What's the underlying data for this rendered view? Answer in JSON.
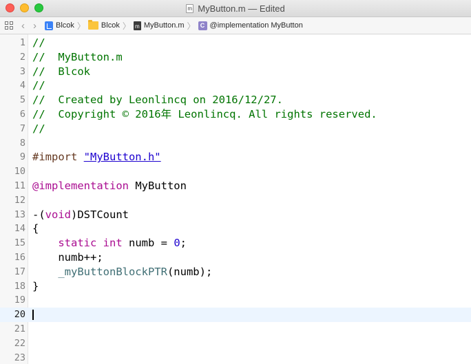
{
  "window": {
    "title": "MyButton.m — Edited",
    "file_badge": "m"
  },
  "jumpbar": {
    "crumbs": [
      {
        "label": "Blcok",
        "icon": "xcode-project-icon"
      },
      {
        "label": "Blcok",
        "icon": "folder-icon"
      },
      {
        "label": "MyButton.m",
        "icon": "objc-m-file-icon",
        "badge": "m"
      },
      {
        "label": "@implementation MyButton",
        "icon": "class-c-icon",
        "badge": "C"
      }
    ]
  },
  "editor": {
    "current_line": 20,
    "lines": [
      {
        "n": "1",
        "tokens": [
          {
            "t": "//",
            "k": "comment"
          }
        ]
      },
      {
        "n": "2",
        "tokens": [
          {
            "t": "//  MyButton.m",
            "k": "comment"
          }
        ]
      },
      {
        "n": "3",
        "tokens": [
          {
            "t": "//  Blcok",
            "k": "comment"
          }
        ]
      },
      {
        "n": "4",
        "tokens": [
          {
            "t": "//",
            "k": "comment"
          }
        ]
      },
      {
        "n": "5",
        "tokens": [
          {
            "t": "//  Created by Leonlincq on 2016/12/27.",
            "k": "comment"
          }
        ]
      },
      {
        "n": "6",
        "tokens": [
          {
            "t": "//  Copyright © 2016年 Leonlincq. All rights reserved.",
            "k": "comment"
          }
        ]
      },
      {
        "n": "7",
        "tokens": [
          {
            "t": "//",
            "k": "comment"
          }
        ]
      },
      {
        "n": "8",
        "tokens": []
      },
      {
        "n": "9",
        "tokens": [
          {
            "t": "#import ",
            "k": "preproc"
          },
          {
            "t": "\"MyButton.h\"",
            "k": "string"
          }
        ]
      },
      {
        "n": "10",
        "tokens": []
      },
      {
        "n": "11",
        "tokens": [
          {
            "t": "@implementation",
            "k": "keyword"
          },
          {
            "t": " MyButton",
            "k": "plain"
          }
        ]
      },
      {
        "n": "12",
        "tokens": []
      },
      {
        "n": "13",
        "tokens": [
          {
            "t": "-(",
            "k": "plain"
          },
          {
            "t": "void",
            "k": "keyword"
          },
          {
            "t": ")DSTCount",
            "k": "plain"
          }
        ]
      },
      {
        "n": "14",
        "tokens": [
          {
            "t": "{",
            "k": "plain"
          }
        ]
      },
      {
        "n": "15",
        "tokens": [
          {
            "t": "    ",
            "k": "plain"
          },
          {
            "t": "static",
            "k": "keyword"
          },
          {
            "t": " ",
            "k": "plain"
          },
          {
            "t": "int",
            "k": "keyword"
          },
          {
            "t": " numb = ",
            "k": "plain"
          },
          {
            "t": "0",
            "k": "number"
          },
          {
            "t": ";",
            "k": "plain"
          }
        ]
      },
      {
        "n": "16",
        "tokens": [
          {
            "t": "    numb++;",
            "k": "plain"
          }
        ]
      },
      {
        "n": "17",
        "tokens": [
          {
            "t": "    ",
            "k": "plain"
          },
          {
            "t": "_myButtonBlockPTR",
            "k": "ident"
          },
          {
            "t": "(numb);",
            "k": "plain"
          }
        ]
      },
      {
        "n": "18",
        "tokens": [
          {
            "t": "}",
            "k": "plain"
          }
        ]
      },
      {
        "n": "19",
        "tokens": []
      },
      {
        "n": "20",
        "tokens": []
      },
      {
        "n": "21",
        "tokens": []
      },
      {
        "n": "22",
        "tokens": []
      },
      {
        "n": "23",
        "tokens": []
      }
    ]
  },
  "colors": {
    "comment": "#007400",
    "keyword": "#aa0d91",
    "string": "#1c00cf",
    "preproc": "#643820",
    "identifier": "#3f6e74",
    "current_line_bg": "#ecf5ff"
  }
}
